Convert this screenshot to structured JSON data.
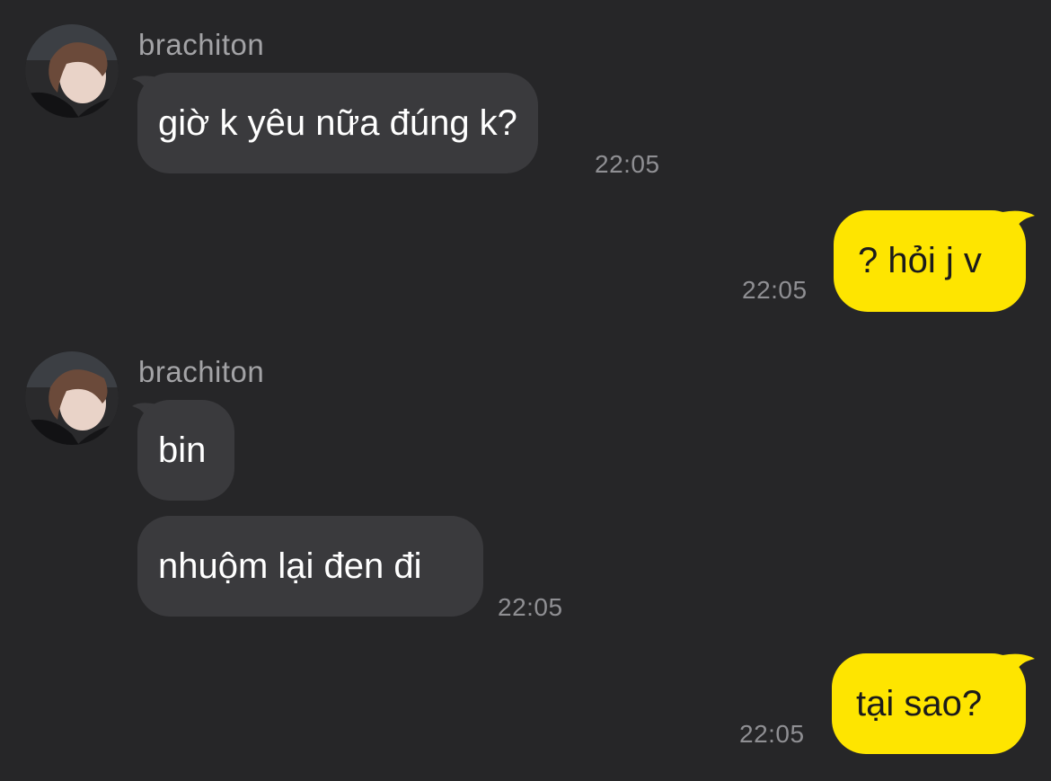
{
  "conversation": {
    "groups": [
      {
        "sender": "brachiton",
        "avatar_icon": "user-avatar-photo",
        "messages": [
          "giờ k yêu nữa đúng k?"
        ],
        "time": "22:05"
      },
      {
        "direction": "outgoing",
        "messages": [
          "? hỏi j v"
        ],
        "time": "22:05"
      },
      {
        "sender": "brachiton",
        "avatar_icon": "user-avatar-photo",
        "messages": [
          "bin",
          "nhuộm lại đen đi"
        ],
        "time": "22:05"
      },
      {
        "direction": "outgoing",
        "messages": [
          "tại sao?"
        ],
        "time": "22:05"
      }
    ]
  },
  "colors": {
    "background": "#262628",
    "incoming_bubble": "#3a3a3d",
    "outgoing_bubble": "#fee500",
    "sender_name": "#a3a3a6",
    "timestamp": "#8f8f93"
  }
}
